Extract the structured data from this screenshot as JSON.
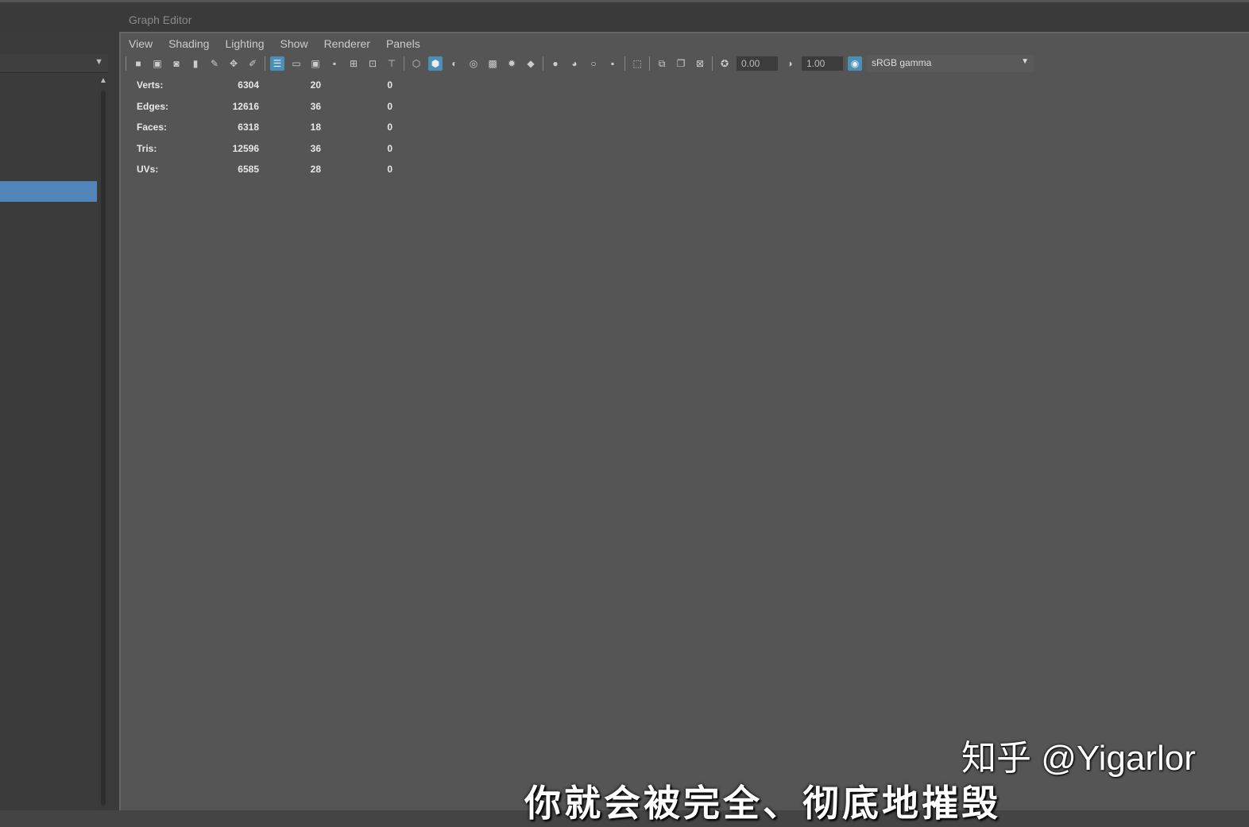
{
  "window": {
    "panel_title": "Graph Editor"
  },
  "menu": [
    "View",
    "Shading",
    "Lighting",
    "Show",
    "Renderer",
    "Panels"
  ],
  "toolbar": {
    "exposure": "0.00",
    "gamma": "1.00",
    "color_space": "sRGB gamma"
  },
  "hud": [
    {
      "label": "Verts:",
      "a": "6304",
      "b": "20",
      "c": "0"
    },
    {
      "label": "Edges:",
      "a": "12616",
      "b": "36",
      "c": "0"
    },
    {
      "label": "Faces:",
      "a": "6318",
      "b": "18",
      "c": "0"
    },
    {
      "label": "Tris:",
      "a": "12596",
      "b": "36",
      "c": "0"
    },
    {
      "label": "UVs:",
      "a": "6585",
      "b": "28",
      "c": "0"
    }
  ],
  "overlay": {
    "watermark": "知乎 @Yigarlor",
    "subtitle": "你就会被完全、彻底地摧毁"
  },
  "colors": {
    "wireframe": "#5fd6c4",
    "selection": "#5285b8"
  }
}
